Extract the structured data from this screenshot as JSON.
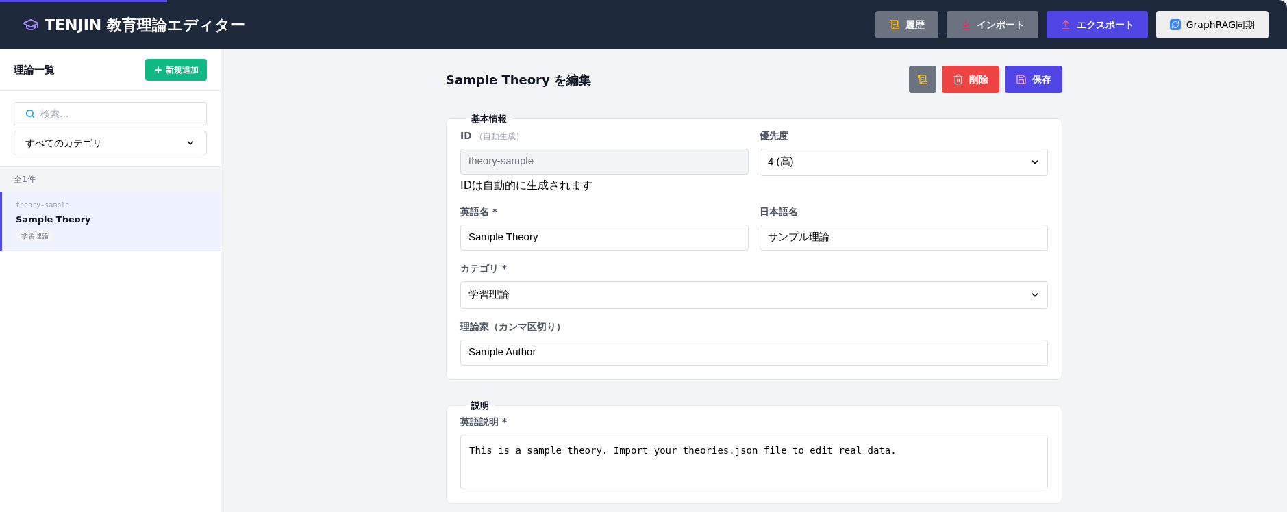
{
  "header": {
    "title": "TENJIN 教育理論エディター",
    "progress": {
      "level": 0.13
    },
    "buttons": [
      {
        "kind": "history",
        "label": "履歴"
      },
      {
        "kind": "import",
        "label": "インポート"
      },
      {
        "kind": "export",
        "label": "エクスポート"
      },
      {
        "kind": "sync",
        "label": "GraphRAG同期"
      }
    ]
  },
  "sidebar": {
    "title": "理論一覧",
    "add_button": "新規追加",
    "search": {
      "placeholder": "検索..."
    },
    "category_filter": {
      "value": "すべてのカテゴリ"
    },
    "count": "全1件",
    "items": [
      {
        "id": "theory-sample",
        "name": "Sample Theory",
        "tag": "学習理論",
        "selected": true
      }
    ]
  },
  "editor": {
    "title": "Sample Theory を編集",
    "actions": [
      {
        "kind": "history"
      },
      {
        "kind": "delete",
        "label": "削除"
      },
      {
        "kind": "save",
        "label": "保存"
      }
    ],
    "sections": [
      {
        "legend": "基本情報",
        "rows": [
          [
            {
              "kind": "readonly",
              "label": "ID",
              "hint": "（自動生成）",
              "value": "theory-sample",
              "help": "IDは自動的に生成されます"
            },
            {
              "kind": "select",
              "label": "優先度",
              "value": "4 (高)"
            }
          ],
          [
            {
              "kind": "text",
              "label": "英語名 *",
              "value": "Sample Theory"
            },
            {
              "kind": "text",
              "label": "日本語名",
              "value": "サンプル理論"
            }
          ],
          [
            {
              "kind": "select",
              "label": "カテゴリ *",
              "value": "学習理論"
            }
          ],
          [
            {
              "kind": "text",
              "label": "理論家（カンマ区切り）",
              "value": "Sample Author"
            }
          ]
        ]
      },
      {
        "legend": "説明",
        "rows": [
          [
            {
              "kind": "textarea",
              "label": "英語説明 *",
              "value": "This is a sample theory. Import your theories.json file to edit real data."
            }
          ]
        ]
      }
    ]
  }
}
